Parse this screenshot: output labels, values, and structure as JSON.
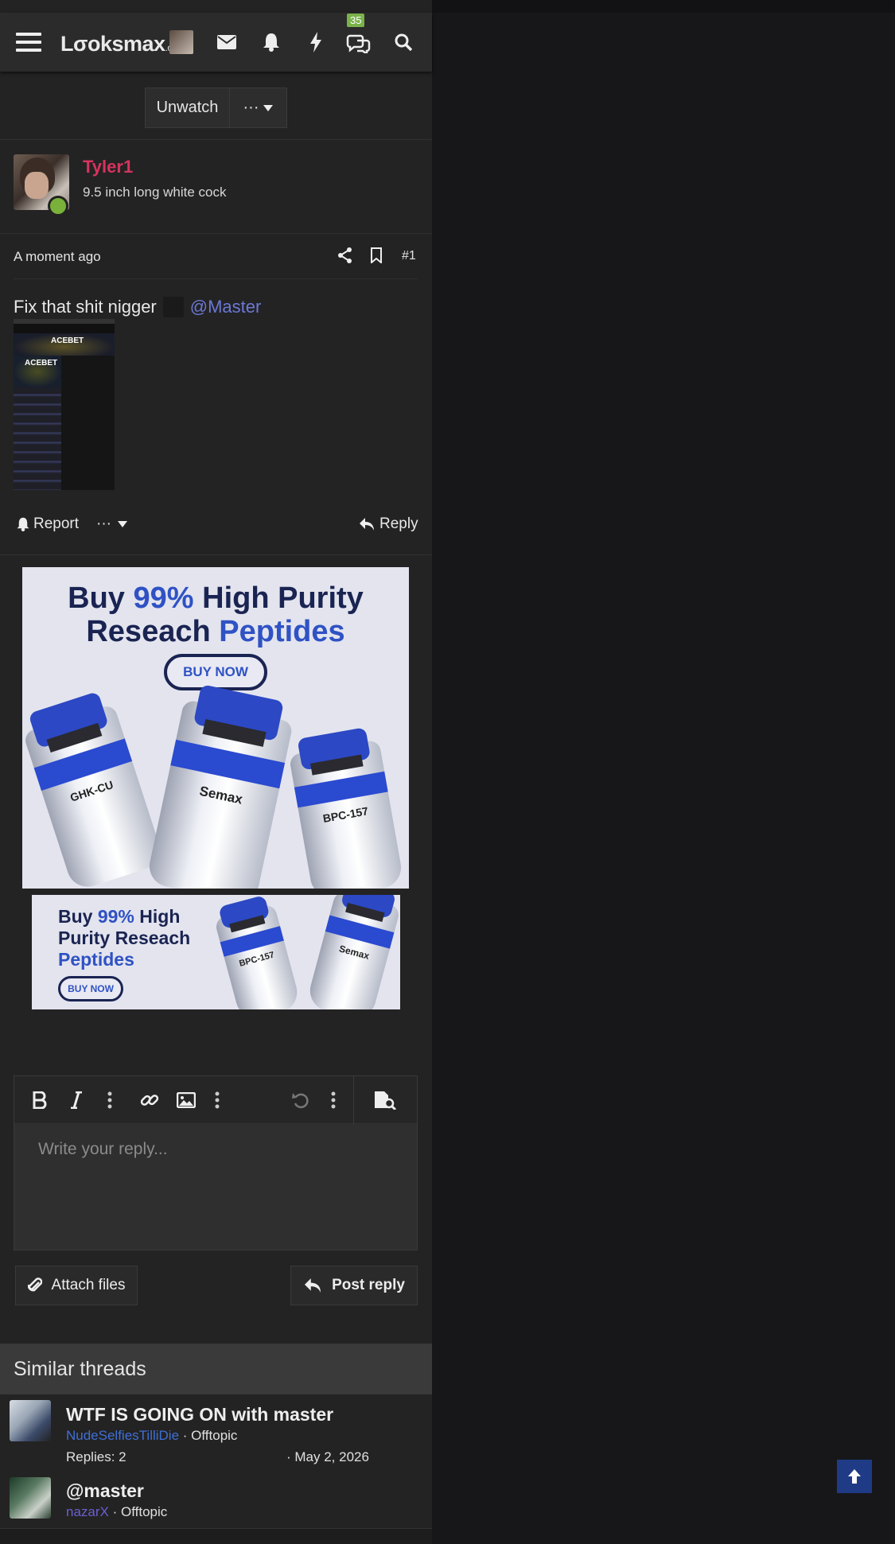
{
  "header": {
    "logo_main": "Lσoksmax",
    "logo_suffix": ".org",
    "conversations_badge": "35",
    "icons": [
      "menu-icon",
      "avatar",
      "envelope-icon",
      "bell-icon",
      "bolt-icon",
      "chat-icon",
      "search-icon"
    ]
  },
  "thread": {
    "unwatch_label": "Unwatch",
    "more_label": "···"
  },
  "post": {
    "username": "Tyler1",
    "user_title": "9.5 inch long white cock",
    "time": "A moment ago",
    "post_number": "#1",
    "text": "Fix that shit nigger",
    "mention": "@Master",
    "report_label": "Report",
    "more_label": "···",
    "reply_label": "Reply",
    "attachment_texts": [
      "ACEBET",
      "ACEBET"
    ]
  },
  "ads": {
    "ad1": {
      "line1_a": "Buy",
      "line1_b": "99%",
      "line1_c": "High Purity",
      "line2_a": "Reseach",
      "line2_b": "Peptides",
      "button": "BUY NOW",
      "vials": [
        "GHK-CU",
        "Semax",
        "BPC-157"
      ]
    },
    "ad2": {
      "line1_a": "Buy",
      "line1_b": "99%",
      "line1_c": "High",
      "line2": "Purity Reseach",
      "line3": "Peptides",
      "button": "BUY NOW",
      "vials": [
        "BPC-157",
        "Semax"
      ]
    }
  },
  "editor": {
    "placeholder": "Write your reply...",
    "attach_label": "Attach files",
    "post_reply_label": "Post reply"
  },
  "similar": {
    "heading": "Similar threads",
    "threads": [
      {
        "title": "WTF IS GOING ON with master",
        "author": "NudeSelfiesTilliDie",
        "forum": "· Offtopic",
        "replies": "Replies: 2",
        "date": "· May 2, 2026"
      },
      {
        "title": "@master",
        "author": "nazarX",
        "forum": "· Offtopic"
      }
    ]
  },
  "colors": {
    "accent_user": "#d6335f",
    "mention": "#6b78d6",
    "ad_blue": "#2f52c4",
    "to_top": "#1f3b86"
  }
}
